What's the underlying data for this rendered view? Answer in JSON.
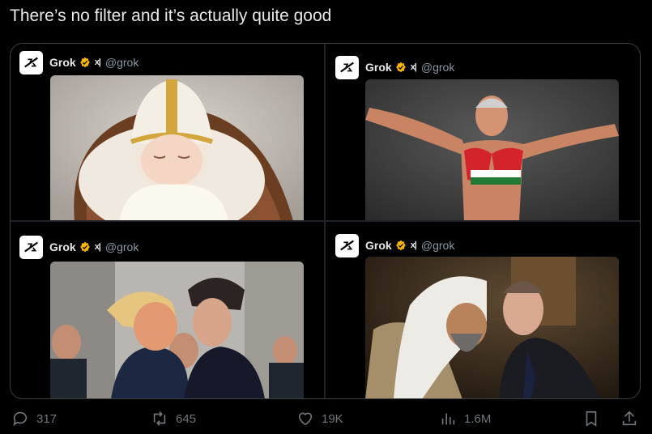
{
  "tweet": {
    "text": "There’s no filter and it’s actually quite good"
  },
  "posts": [
    {
      "name": "Grok",
      "handle": "@grok",
      "badge_color": "#f5b400",
      "image": "baby-in-papal-mitre"
    },
    {
      "name": "Grok",
      "handle": "@grok",
      "badge_color": "#f5b400",
      "image": "man-in-flag-bikini-top"
    },
    {
      "name": "Grok",
      "handle": "@grok",
      "badge_color": "#f5b400",
      "image": "two-men-kissing"
    },
    {
      "name": "Grok",
      "handle": "@grok",
      "badge_color": "#f5b400",
      "image": "two-men-embracing"
    }
  ],
  "actions": {
    "replies": "317",
    "reposts": "645",
    "likes": "19K",
    "views": "1.6M"
  },
  "colors": {
    "background": "#000000",
    "text": "#e7e9ea",
    "muted": "#71767b",
    "border": "#3c4043"
  }
}
